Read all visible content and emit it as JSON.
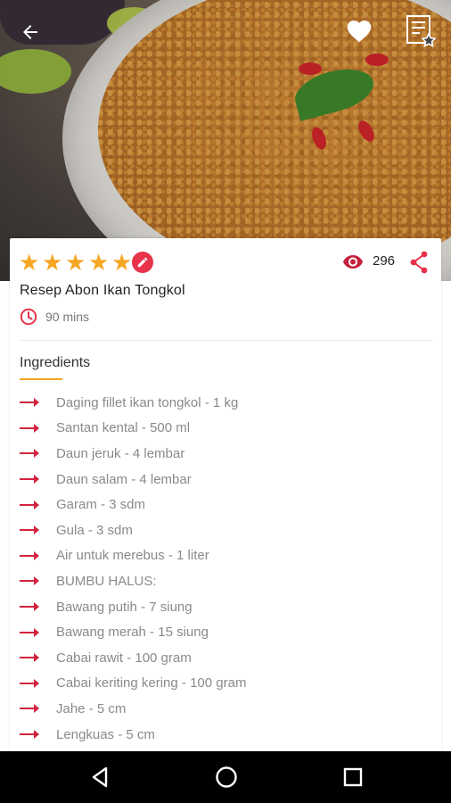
{
  "header": {
    "back_icon": "arrow-left-icon",
    "favorite_icon": "heart-icon",
    "bookmark_icon": "bookmark-list-star-icon"
  },
  "recipe": {
    "rating": 5,
    "rating_max": 5,
    "views": "296",
    "title": "Resep Abon Ikan Tongkol",
    "time": "90 mins"
  },
  "ingredients_section": {
    "title": "Ingredients",
    "items": [
      "Daging fillet ikan tongkol - 1 kg",
      "Santan kental - 500 ml",
      "Daun jeruk - 4 lembar",
      "Daun salam - 4 lembar",
      "Garam - 3 sdm",
      "Gula - 3 sdm",
      "Air untuk merebus - 1 liter",
      "BUMBU HALUS:",
      "Bawang putih - 7 siung",
      "Bawang merah - 15 siung",
      "Cabai rawit - 100 gram",
      "Cabai keriting kering - 100 gram",
      "Jahe - 5 cm",
      "Lengkuas - 5 cm"
    ]
  },
  "colors": {
    "accent_red": "#e8334a",
    "star_orange": "#f5a623"
  },
  "navbar": {
    "back_icon": "triangle-back-icon",
    "home_icon": "circle-home-icon",
    "recents_icon": "square-recents-icon"
  }
}
